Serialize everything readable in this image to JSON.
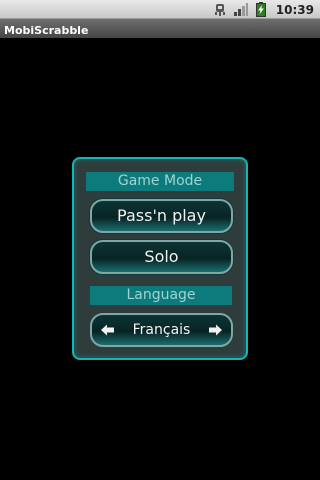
{
  "status_bar": {
    "time": "10:39",
    "icons": [
      "usb-debug-icon",
      "signal-icon",
      "battery-charging-icon"
    ]
  },
  "app": {
    "title": "MobiScrabble"
  },
  "panel": {
    "game_mode_header": "Game Mode",
    "pass_n_play_label": "Pass'n play",
    "solo_label": "Solo",
    "language_header": "Language",
    "language_value": "Français",
    "prev_icon": "arrow-left-icon",
    "next_icon": "arrow-right-icon"
  },
  "colors": {
    "accent": "#13b5b5",
    "header_bg": "#0d7b7b",
    "header_text": "#9fd3d3",
    "panel_bg": "#2e3c3c",
    "background": "#000000"
  }
}
